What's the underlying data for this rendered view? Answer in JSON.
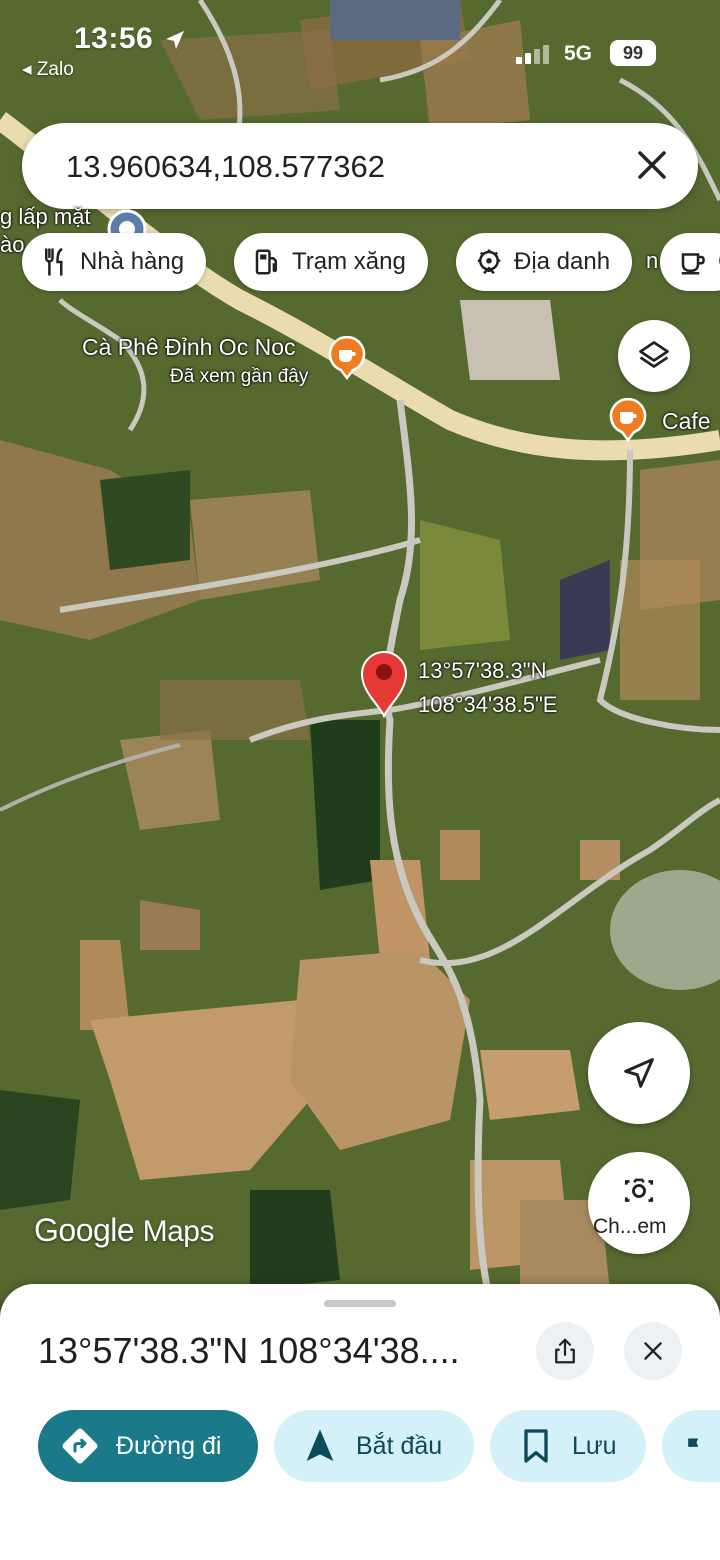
{
  "status_bar": {
    "time": "13:56",
    "back_app": "◂ Zalo",
    "network": "5G",
    "battery": "99"
  },
  "search": {
    "value": "13.960634,108.577362",
    "clear_icon": "close-icon"
  },
  "chips": [
    {
      "label": "Nhà hàng",
      "icon": "fork-knife-icon"
    },
    {
      "label": "Trạm xăng",
      "icon": "gas-station-icon"
    },
    {
      "label": "Địa danh",
      "icon": "landmark-icon"
    },
    {
      "label": "C",
      "icon": "coffee-cup-icon"
    }
  ],
  "map": {
    "labels": {
      "left_partial_1": "g lấp mặt",
      "left_partial_2": "ào",
      "cafe_name": "Cà Phê Đỉnh Oc Noc",
      "cafe_sub": "Đã xem gần đây",
      "cafe_right": "Cafe",
      "chip_overflow": "n"
    },
    "pin_coords": {
      "lat": "13°57'38.3\"N",
      "lng": "108°34'38.5\"E"
    },
    "logo": {
      "google": "Google",
      "maps": "Maps"
    },
    "camera_label": "Ch...em",
    "colors": {
      "pin_red": "#e53935",
      "poi_orange": "#f07c22",
      "road": "#efe3b2"
    }
  },
  "sheet": {
    "title": "13°57'38.3\"N 108°34'38....",
    "actions": [
      {
        "label": "Đường đi",
        "icon": "directions-icon"
      },
      {
        "label": "Bắt đầu",
        "icon": "navigation-arrow-icon"
      },
      {
        "label": "Lưu",
        "icon": "bookmark-icon"
      },
      {
        "label": "",
        "icon": "flag-icon"
      }
    ]
  }
}
